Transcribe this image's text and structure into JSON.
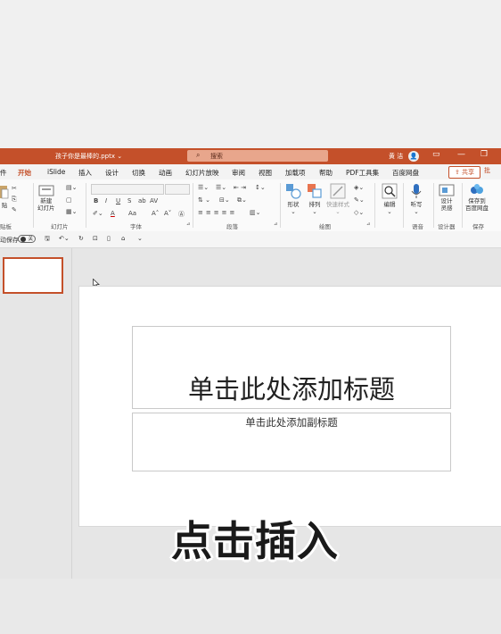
{
  "window": {
    "filename": "孩子你是最棒的.pptx ⌄",
    "search_placeholder": "搜索",
    "user_name": "黄 洁",
    "minimize": "—",
    "restore": "❐",
    "close": "✕"
  },
  "tabs": [
    {
      "label": "件"
    },
    {
      "label": "开始"
    },
    {
      "label": "iSlide"
    },
    {
      "label": "插入"
    },
    {
      "label": "设计"
    },
    {
      "label": "切换"
    },
    {
      "label": "动画"
    },
    {
      "label": "幻灯片放映"
    },
    {
      "label": "审阅"
    },
    {
      "label": "视图"
    },
    {
      "label": "加载项"
    },
    {
      "label": "帮助"
    },
    {
      "label": "PDF工具集"
    },
    {
      "label": "百度网盘"
    }
  ],
  "share_label": "共享",
  "share2_label": "批",
  "ribbon": {
    "paste_label": "贴",
    "new_slide_label": "新建\n幻灯片",
    "font_group": "字体",
    "paragraph_group": "段落",
    "drawing_group": "绘图",
    "clipboard_group": "贴板",
    "slides_group": "幻灯片",
    "shape_label": "形状",
    "arrange_label": "排列",
    "quick_style_label": "快速样式",
    "edit_label": "编辑",
    "dictate_label": "听写",
    "voice_group": "语音",
    "designer_label": "设计\n灵感",
    "designer_group": "设计器",
    "save_baidu_label": "保存到\n百度网盘",
    "save_group": "保存",
    "bold": "B",
    "italic": "I",
    "underline": "U",
    "strike": "S",
    "spacing": "AV",
    "fontcolor": "A",
    "case": "Aa",
    "grow": "A˄",
    "shrink": "A˅"
  },
  "qat": {
    "autosave_label": "动保存",
    "autosave_state": "关"
  },
  "slide": {
    "title_placeholder": "单击此处添加标题",
    "subtitle_placeholder": "单击此处添加副标题"
  },
  "caption": "点击插入",
  "colors": {
    "accent": "#c4502a"
  }
}
